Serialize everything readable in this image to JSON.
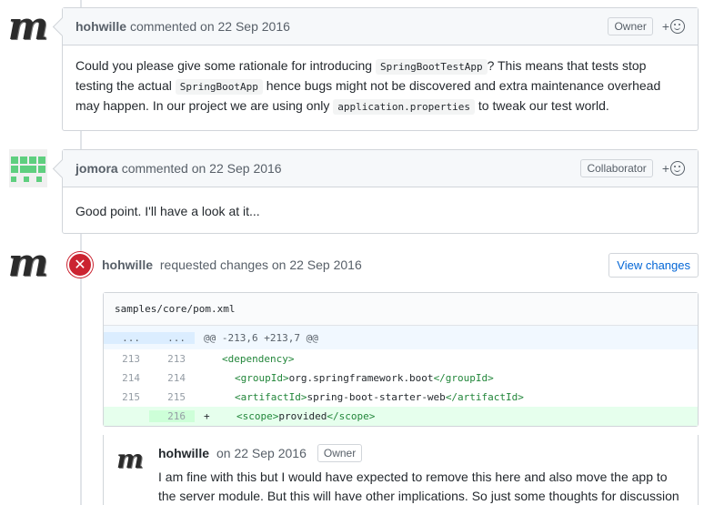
{
  "comments": [
    {
      "author": "hohwille",
      "meta": "commented on 22 Sep 2016",
      "badge": "Owner",
      "react": "+",
      "body": {
        "t1": "Could you please give some rationale for introducing",
        "c1": "SpringBootTestApp",
        "t2": "? This means that tests stop testing the actual",
        "c2": "SpringBootApp",
        "t3": "hence bugs might not be discovered and extra maintenance overhead may happen. In our project we are using only",
        "c3": "application.properties",
        "t4": "to tweak our test world."
      }
    },
    {
      "author": "jomora",
      "meta": "commented on 22 Sep 2016",
      "badge": "Collaborator",
      "react": "+",
      "body": "Good point. I'll have a look at it..."
    }
  ],
  "review": {
    "author": "hohwille",
    "meta": "requested changes on 22 Sep 2016",
    "button": "View changes",
    "file": "samples/core/pom.xml",
    "hunk": {
      "old": "...",
      "new": "...",
      "text": "@@ -213,6 +213,7 @@"
    },
    "lines": [
      {
        "old": "213",
        "new": "213",
        "sign": "",
        "open": "<dependency>",
        "value": "",
        "close": ""
      },
      {
        "old": "214",
        "new": "214",
        "sign": "",
        "open": "<groupId>",
        "value": "org.springframework.boot",
        "close": "</groupId>"
      },
      {
        "old": "215",
        "new": "215",
        "sign": "",
        "open": "<artifactId>",
        "value": "spring-boot-starter-web",
        "close": "</artifactId>"
      },
      {
        "old": "",
        "new": "216",
        "sign": "+",
        "open": "<scope>",
        "value": "provided",
        "close": "</scope>"
      }
    ],
    "inline": {
      "author": "hohwille",
      "meta": "on 22 Sep 2016",
      "badge": "Owner",
      "body": "I am fine with this but I would have expected to remove this here and also move the app to the server module. But this will have other implications. So just some thoughts for discussion"
    }
  },
  "icons": [
    "avatar-hohwille",
    "avatar-jomora",
    "smiley-icon",
    "x-circle-icon"
  ],
  "colors": {
    "red": "#cb2431",
    "blue": "#0366d6",
    "green_add": "#e6ffed",
    "hunk_blue": "#f1f8ff"
  }
}
